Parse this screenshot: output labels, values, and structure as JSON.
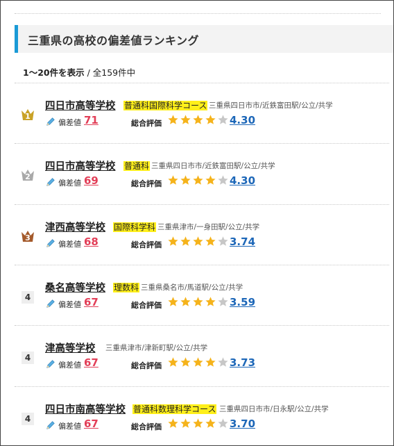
{
  "heading": {
    "title": "三重県の高校の偏差値ランキング"
  },
  "count": {
    "range": "1～20件を表示",
    "sep": " / ",
    "total": "全159件中"
  },
  "labels": {
    "deviation": "偏差値",
    "rating": "総合評価"
  },
  "colors": {
    "accent": "#1a9ad6",
    "highlight": "#ffef1a",
    "deviation": "#e23e57",
    "rating": "#1d67b8",
    "star": "#f5b31b",
    "star_empty": "#c7c7c7",
    "gold": "#c9a227",
    "silver": "#a9a9a9",
    "bronze": "#a45a2b"
  },
  "icons": {
    "pencil": "pencil-icon",
    "star": "star-icon",
    "crown": "crown-icon"
  },
  "schools": [
    {
      "rank": "1",
      "name": "四日市高等学校",
      "course": "普通科国際科学コース",
      "location": "三重県四日市市/近鉄富田駅/公立/共学",
      "deviation": "71",
      "rating": "4.30",
      "stars": 4
    },
    {
      "rank": "2",
      "name": "四日市高等学校",
      "course": "普通科",
      "location": "三重県四日市市/近鉄富田駅/公立/共学",
      "deviation": "69",
      "rating": "4.30",
      "stars": 4
    },
    {
      "rank": "3",
      "name": "津西高等学校",
      "course": "国際科学科",
      "location": "三重県津市/一身田駅/公立/共学",
      "deviation": "68",
      "rating": "3.74",
      "stars": 4
    },
    {
      "rank": "4",
      "name": "桑名高等学校",
      "course": "理数科",
      "location": "三重県桑名市/馬道駅/公立/共学",
      "deviation": "67",
      "rating": "3.59",
      "stars": 4
    },
    {
      "rank": "4",
      "name": "津高等学校",
      "course": "",
      "location": "三重県津市/津新町駅/公立/共学",
      "deviation": "67",
      "rating": "3.73",
      "stars": 4
    },
    {
      "rank": "4",
      "name": "四日市南高等学校",
      "course": "普通科数理科学コース",
      "location": "三重県四日市市/日永駅/公立/共学",
      "deviation": "67",
      "rating": "3.70",
      "stars": 4
    }
  ]
}
